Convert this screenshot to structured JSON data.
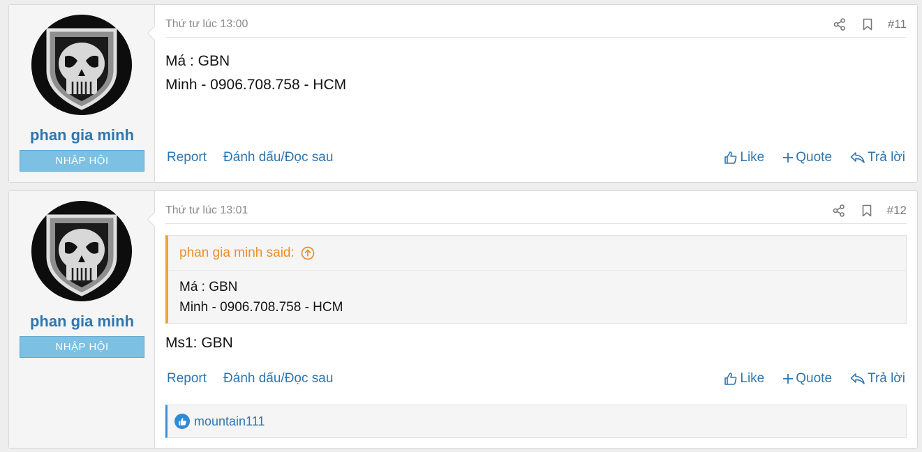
{
  "posts": [
    {
      "username": "phan gia minh",
      "badge": "NHẬP HỘI",
      "date": "Thứ tư lúc 13:00",
      "number": "#11",
      "body": [
        "Má : GBN",
        "Minh - 0906.708.758 - HCM"
      ],
      "actions_left": [
        "Report",
        "Đánh dấu/Đọc sau"
      ],
      "actions_right": [
        "Like",
        "Quote",
        "Trả lời"
      ]
    },
    {
      "username": "phan gia minh",
      "badge": "NHẬP HỘI",
      "date": "Thứ tư lúc 13:01",
      "number": "#12",
      "quote": {
        "author": "phan gia minh said:",
        "lines": [
          "Má : GBN",
          "Minh - 0906.708.758 - HCM"
        ]
      },
      "body": [
        "Ms1: GBN"
      ],
      "actions_left": [
        "Report",
        "Đánh dấu/Đọc sau"
      ],
      "actions_right": [
        "Like",
        "Quote",
        "Trả lời"
      ],
      "reactions": "mountain111"
    }
  ],
  "icons": {
    "share": "share-icon",
    "bookmark": "bookmark-icon",
    "like": "thumbs-up-icon",
    "quote": "plus-icon",
    "reply": "reply-icon",
    "quote_jump": "arrow-up-circle-icon"
  },
  "colors": {
    "link": "#2e76b0",
    "badge": "#7cc0e3",
    "quote_accent": "#f0a33c",
    "reaction_accent": "#3a92d6"
  }
}
